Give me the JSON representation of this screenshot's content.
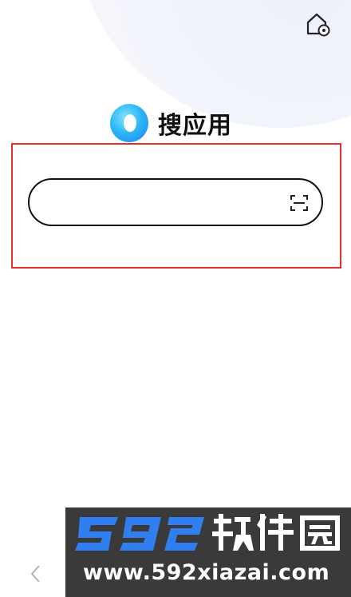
{
  "app": {
    "title": "搜应用",
    "logo_icon": "app-search-logo-icon",
    "accent_color": "#1f7cf0"
  },
  "toolbar": {
    "home_settings_icon": "home-settings-icon"
  },
  "search": {
    "value": "",
    "placeholder": "",
    "scan_icon": "scan-icon",
    "highlight_color": "#e0302e"
  },
  "nav": {
    "back_icon": "chevron-left-icon"
  },
  "watermark": {
    "logo_text": "592软件园",
    "url": "www.592xiazai.com"
  }
}
